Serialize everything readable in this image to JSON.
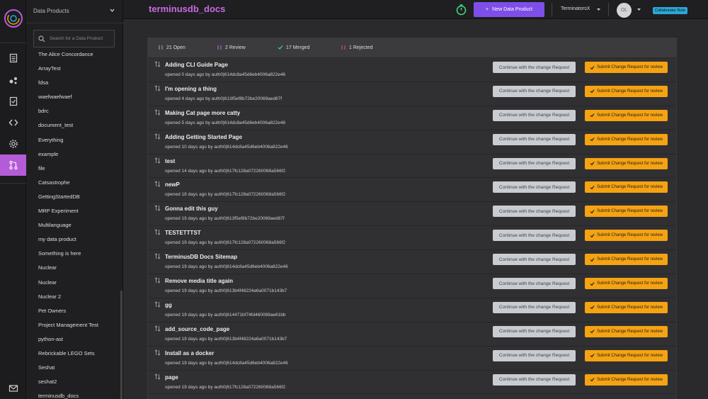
{
  "sidebar": {
    "header": "Data Products",
    "search_placeholder": "Search for a Data Product",
    "items": [
      "The Alice Concordance",
      "ArrayTest",
      "fdsa",
      "waefwaefwaef",
      "bdrc",
      "document_test",
      "Everything",
      "example",
      "file",
      "Catsastrophe",
      "GettingStartedDB",
      "MRP Experiment",
      "Multilanguage",
      "my data product",
      "Something is here",
      "Nuclear",
      "Nuclear",
      "Nuclear 2",
      "Pet Owners",
      "Project Management Test",
      "python-ast",
      "Rebrickable LEGO Sets",
      "Seshat",
      "seshat2",
      "terminusdb_docs"
    ]
  },
  "topbar": {
    "title": "terminusdb_docs",
    "new_button": "New Data Product",
    "team": "TerminatorsX",
    "avatar_initials": "OL",
    "role": "Collaborator Role"
  },
  "stats": {
    "open": "21 Open",
    "review": "2 Review",
    "merged": "17 Merged",
    "rejected": "1 Rejected"
  },
  "buttons": {
    "continue": "Continue with the change Request",
    "submit": "Submit Change Request for review"
  },
  "requests": [
    {
      "title": "Adding CLI Guide Page",
      "sub": "opened 0 days ago by auth0|614dc8a45d6eb4006a822e46"
    },
    {
      "title": "I'm opening a thing",
      "sub": "opened 4 days ago by auth0|613f5ef8b72be20069aed87f"
    },
    {
      "title": "Making Cat page more catty",
      "sub": "opened 5 days ago by auth0|614dc8a45d6eb4006a822e46"
    },
    {
      "title": "Adding Getting Started Page",
      "sub": "opened 10 days ago by auth0|614dc8a45d6eb4006a822e46"
    },
    {
      "title": "test",
      "sub": "opened 14 days ago by auth0|617fc128a072260068a566f2"
    },
    {
      "title": "newP",
      "sub": "opened 18 days ago by auth0|617fc128a072260068a566f2"
    },
    {
      "title": "Gonna edit this guy",
      "sub": "opened 19 days ago by auth0|613f5ef8b72be20069aed87f"
    },
    {
      "title": "TESTETTTST",
      "sub": "opened 19 days ago by auth0|617fc128a072260068a566f2"
    },
    {
      "title": "TerminusDB Docs Sitemap",
      "sub": "opened 19 days ago by auth0|614dc8a45d6eb4006a822e46"
    },
    {
      "title": "Remove media title again",
      "sub": "opened 19 days ago by auth0|613b4f48224a6a0071b143b7"
    },
    {
      "title": "gg",
      "sub": "opened 19 days ago by auth0|614471bf74fd460069ae61bb"
    },
    {
      "title": "add_source_code_page",
      "sub": "opened 19 days ago by auth0|613b4f48224a6a0071b143b7"
    },
    {
      "title": "Install as a docker",
      "sub": "opened 19 days ago by auth0|614dc8a45d6eb4006a822e46"
    },
    {
      "title": "page",
      "sub": "opened 19 days ago by auth0|617fc128a072260068a566f2"
    }
  ],
  "colors": {
    "accent": "#c86ae0",
    "primary_button": "#7e4fe8",
    "submit_button": "#f5a312",
    "role_badge": "#2ba7d6"
  }
}
